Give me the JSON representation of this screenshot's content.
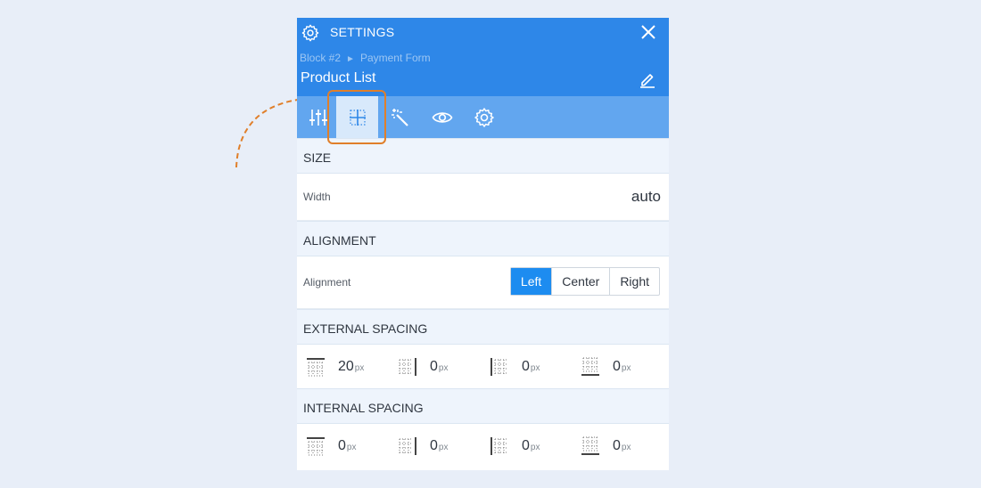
{
  "header": {
    "title": "SETTINGS",
    "breadcrumb": [
      "Block #2",
      "Payment Form"
    ],
    "breadcrumb_sep": "►",
    "name": "Product List",
    "color": "#2e87e8"
  },
  "tabs": [
    {
      "icon": "sliders-icon",
      "active": false
    },
    {
      "icon": "layout-grid-icon",
      "active": true
    },
    {
      "icon": "magic-wand-icon",
      "active": false
    },
    {
      "icon": "eye-icon",
      "active": false
    },
    {
      "icon": "gear-icon",
      "active": false
    }
  ],
  "size": {
    "section_title": "SIZE",
    "width_label": "Width",
    "width_value": "auto"
  },
  "alignment": {
    "section_title": "ALIGNMENT",
    "label": "Alignment",
    "options": [
      "Left",
      "Center",
      "Right"
    ],
    "selected": "Left",
    "accent": "#1d8cf0"
  },
  "external_spacing": {
    "section_title": "EXTERNAL SPACING",
    "unit": "px",
    "top": "20",
    "right": "0",
    "left": "0",
    "bottom": "0"
  },
  "internal_spacing": {
    "section_title": "INTERNAL SPACING",
    "unit": "px",
    "top": "0",
    "right": "0",
    "left": "0",
    "bottom": "0"
  },
  "highlight_color": "#e07f2a"
}
